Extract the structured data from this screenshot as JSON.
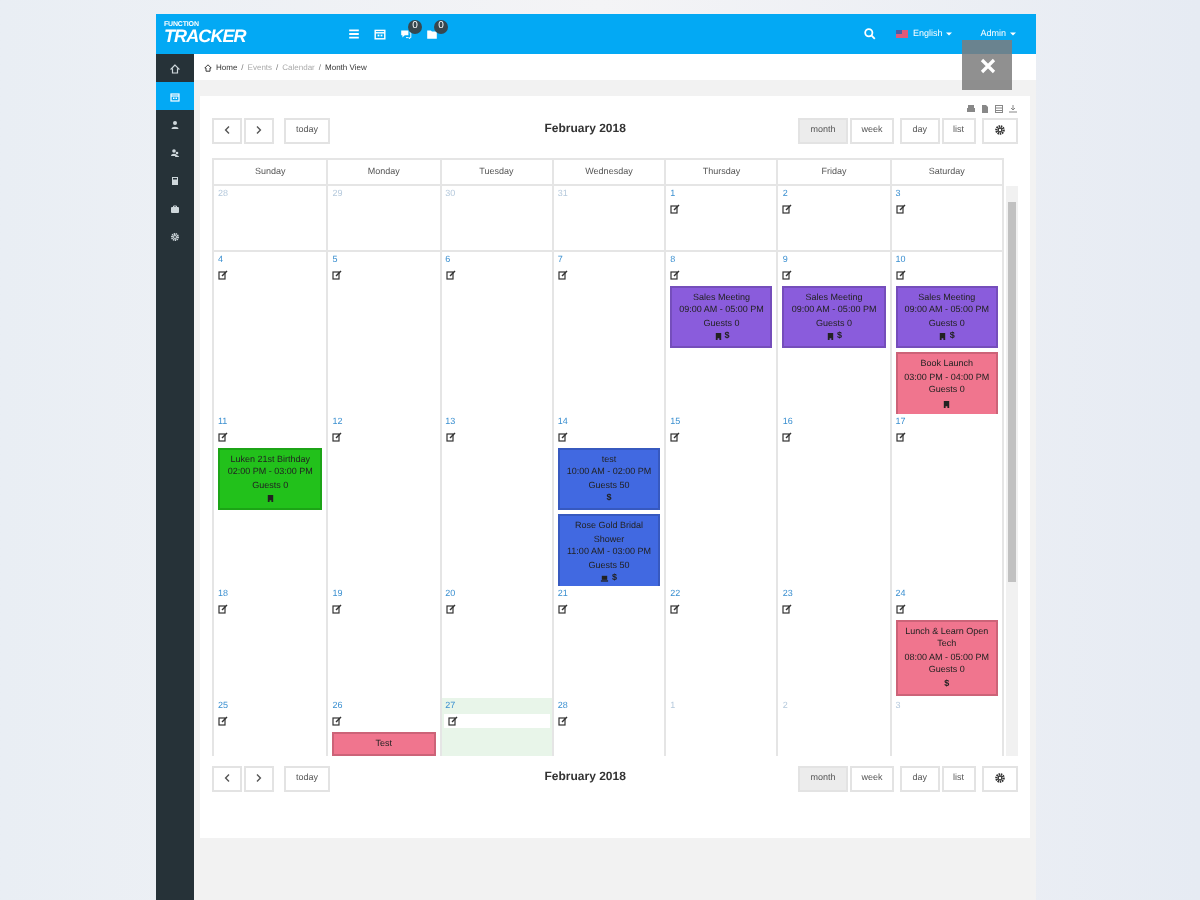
{
  "logo": {
    "top": "FUNCTION",
    "main": "TRACKER"
  },
  "header": {
    "icons": [
      {
        "kind": "list"
      },
      {
        "kind": "calendar"
      },
      {
        "kind": "chat",
        "badge": "0"
      },
      {
        "kind": "folder",
        "badge": "0"
      }
    ],
    "language": "English",
    "user": "Admin"
  },
  "sidebar": {
    "items": [
      {
        "kind": "home",
        "selected": false
      },
      {
        "kind": "calendar",
        "selected": true
      },
      {
        "kind": "user",
        "selected": false
      },
      {
        "kind": "users",
        "selected": false
      },
      {
        "kind": "calculator",
        "selected": false
      },
      {
        "kind": "briefcase",
        "selected": false
      },
      {
        "kind": "gear",
        "selected": false
      }
    ]
  },
  "breadcrumb": {
    "separator": "/",
    "items": [
      "Home",
      "Events",
      "Calendar",
      "Month View"
    ]
  },
  "toolbars": [
    {
      "today": "today",
      "title": "February 2018",
      "views": [
        {
          "label": "month",
          "selected": true
        },
        {
          "label": "week",
          "selected": false
        },
        {
          "label": "day",
          "selected": false
        },
        {
          "label": "list",
          "selected": false
        }
      ]
    },
    {
      "today": "today",
      "title": "February 2018",
      "views": [
        {
          "label": "month",
          "selected": true
        },
        {
          "label": "week",
          "selected": false
        },
        {
          "label": "day",
          "selected": false
        },
        {
          "label": "list",
          "selected": false
        }
      ]
    }
  ],
  "calendar": {
    "days": [
      "Sunday",
      "Monday",
      "Tuesday",
      "Wednesday",
      "Thursday",
      "Friday",
      "Saturday"
    ],
    "weeks": [
      [
        {
          "day": "28",
          "other_month": true,
          "today": false
        },
        {
          "day": "29",
          "other_month": true,
          "today": false
        },
        {
          "day": "30",
          "other_month": true,
          "today": false
        },
        {
          "day": "31",
          "other_month": true,
          "today": false
        },
        {
          "day": "1",
          "other_month": false,
          "today": false
        },
        {
          "day": "2",
          "other_month": false,
          "today": false
        },
        {
          "day": "3",
          "other_month": false,
          "today": false
        }
      ],
      [
        {
          "day": "4",
          "other_month": false,
          "today": false
        },
        {
          "day": "5",
          "other_month": false,
          "today": false
        },
        {
          "day": "6",
          "other_month": false,
          "today": false
        },
        {
          "day": "7",
          "other_month": false,
          "today": false
        },
        {
          "day": "8",
          "other_month": false,
          "today": false,
          "events": [
            {
              "title": "Sales Meeting",
              "time": "09:00 AM - 05:00 PM",
              "guests": "Guests 0",
              "icons": [
                {
                  "kind": "building"
                }
              ],
              "price": "$",
              "color": "#8a5cdc"
            }
          ]
        },
        {
          "day": "9",
          "other_month": false,
          "today": false,
          "events": [
            {
              "title": "Sales Meeting",
              "time": "09:00 AM - 05:00 PM",
              "guests": "Guests 0",
              "icons": [
                {
                  "kind": "building"
                }
              ],
              "price": "$",
              "color": "#8a5cdc"
            }
          ]
        },
        {
          "day": "10",
          "other_month": false,
          "today": false,
          "events": [
            {
              "title": "Sales Meeting",
              "time": "09:00 AM - 05:00 PM",
              "guests": "Guests 0",
              "icons": [
                {
                  "kind": "building"
                }
              ],
              "price": "$",
              "color": "#8a5cdc"
            },
            {
              "title": "Book Launch",
              "time": "03:00 PM - 04:00 PM",
              "guests": "Guests 0",
              "icons": [
                {
                  "kind": "building"
                }
              ],
              "color": "#f0758e"
            }
          ]
        }
      ],
      [
        {
          "day": "11",
          "other_month": false,
          "today": false,
          "events": [
            {
              "title": "Luken 21st Birthday",
              "time": "02:00 PM - 03:00 PM",
              "guests": "Guests 0",
              "icons": [
                {
                  "kind": "building"
                }
              ],
              "color": "#22c11b"
            }
          ]
        },
        {
          "day": "12",
          "other_month": false,
          "today": false
        },
        {
          "day": "13",
          "other_month": false,
          "today": false
        },
        {
          "day": "14",
          "other_month": false,
          "today": false,
          "events": [
            {
              "title": "test",
              "time": "10:00 AM - 02:00 PM",
              "guests": "Guests 50",
              "price": "$",
              "color": "#4169e1"
            },
            {
              "title": "Rose Gold Bridal Shower",
              "time": "11:00 AM - 03:00 PM",
              "guests": "Guests 50",
              "icons": [
                {
                  "kind": "laptop"
                }
              ],
              "price": "$",
              "color": "#4169e1"
            }
          ]
        },
        {
          "day": "15",
          "other_month": false,
          "today": false
        },
        {
          "day": "16",
          "other_month": false,
          "today": false
        },
        {
          "day": "17",
          "other_month": false,
          "today": false
        }
      ],
      [
        {
          "day": "18",
          "other_month": false,
          "today": false
        },
        {
          "day": "19",
          "other_month": false,
          "today": false
        },
        {
          "day": "20",
          "other_month": false,
          "today": false
        },
        {
          "day": "21",
          "other_month": false,
          "today": false
        },
        {
          "day": "22",
          "other_month": false,
          "today": false
        },
        {
          "day": "23",
          "other_month": false,
          "today": false
        },
        {
          "day": "24",
          "other_month": false,
          "today": false,
          "events": [
            {
              "title": "Lunch & Learn Open Tech",
              "time": "08:00 AM - 05:00 PM",
              "guests": "Guests 0",
              "price": "$",
              "color": "#f0758e"
            }
          ]
        }
      ],
      [
        {
          "day": "25",
          "other_month": false,
          "today": false
        },
        {
          "day": "26",
          "other_month": false,
          "today": false,
          "events": [
            {
              "title": "Test",
              "color": "#f0758e"
            }
          ]
        },
        {
          "day": "27",
          "other_month": false,
          "today": true
        },
        {
          "day": "28",
          "other_month": false,
          "today": false
        },
        {
          "day": "1",
          "other_month": true,
          "today": false
        },
        {
          "day": "2",
          "other_month": true,
          "today": false
        },
        {
          "day": "3",
          "other_month": true,
          "today": false
        }
      ]
    ]
  }
}
